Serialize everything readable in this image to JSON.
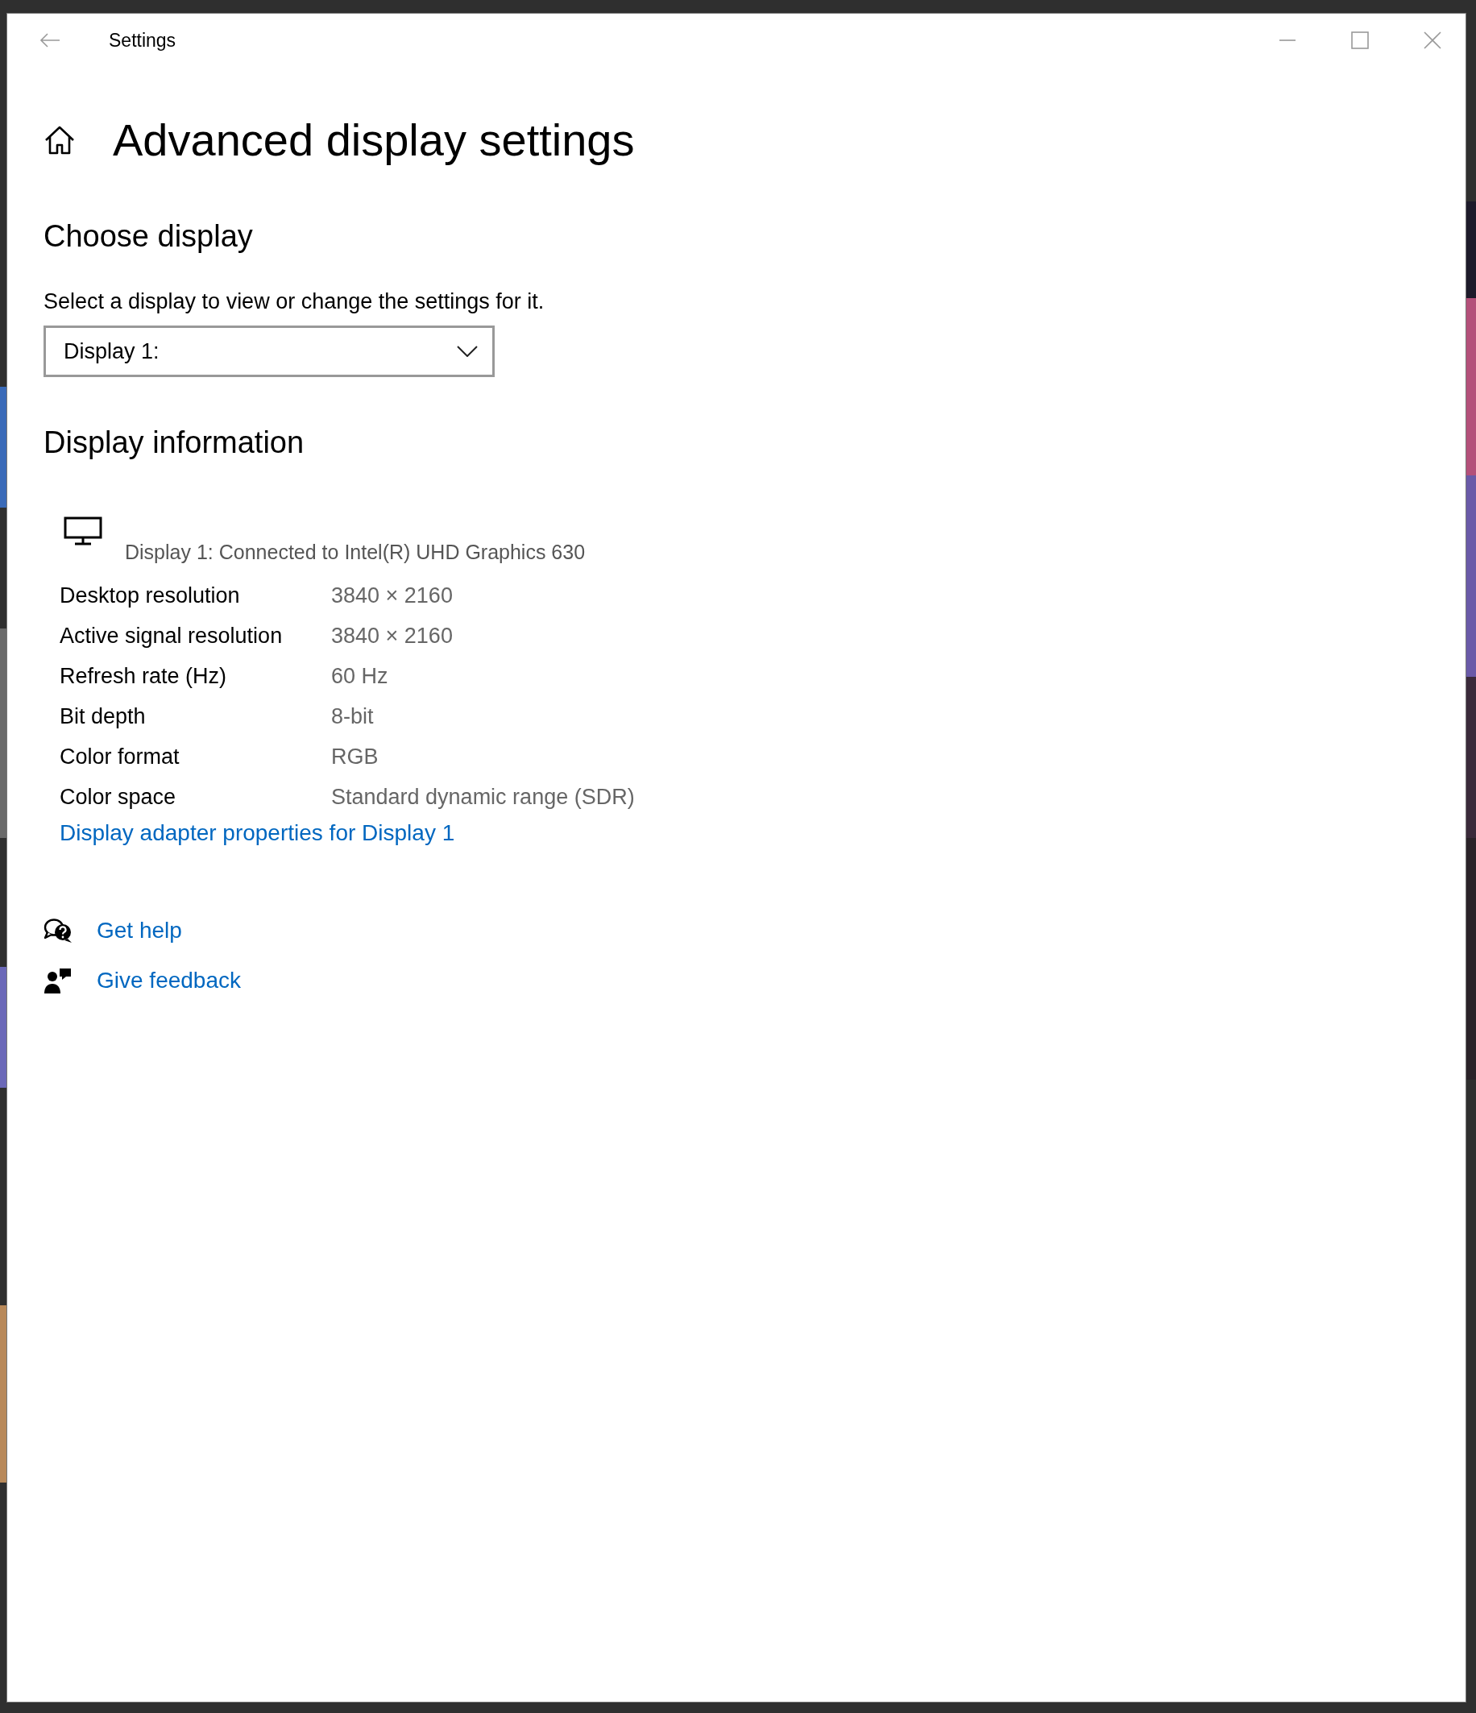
{
  "window": {
    "title": "Settings"
  },
  "page_title": "Advanced display settings",
  "choose_display": {
    "heading": "Choose display",
    "description": "Select a display to view or change the settings for it.",
    "dropdown": {
      "value": "Display 1:"
    }
  },
  "display_information": {
    "heading": "Display information",
    "caption": "Display 1: Connected to Intel(R) UHD Graphics 630",
    "rows": [
      {
        "label": "Desktop resolution",
        "value": "3840 × 2160"
      },
      {
        "label": "Active signal resolution",
        "value": "3840 × 2160"
      },
      {
        "label": "Refresh rate (Hz)",
        "value": "60 Hz"
      },
      {
        "label": "Bit depth",
        "value": "8-bit"
      },
      {
        "label": "Color format",
        "value": "RGB"
      },
      {
        "label": "Color space",
        "value": "Standard dynamic range (SDR)"
      }
    ],
    "link": "Display adapter properties for Display 1"
  },
  "help_links": [
    {
      "kind": "help",
      "label": "Get help"
    },
    {
      "kind": "feedback",
      "label": "Give feedback"
    }
  ]
}
